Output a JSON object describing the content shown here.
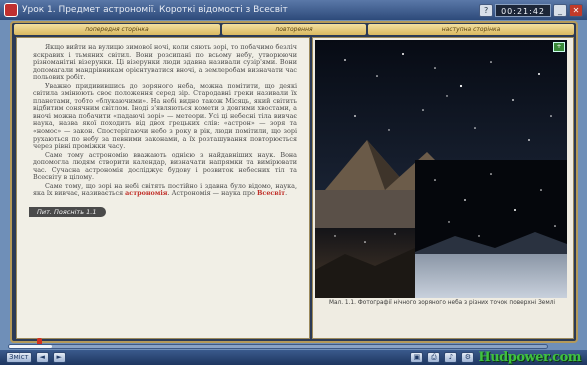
{
  "window": {
    "title": "Урок 1. Предмет астрономії. Короткі відомості з Всесвіт",
    "counter": "00:21:42",
    "buttons": {
      "help": "?",
      "minimize": "_",
      "close": "✕"
    }
  },
  "nav": {
    "tabs": [
      {
        "label": "попередня сторінка"
      },
      {
        "label": "повторення"
      },
      {
        "label": "наступна сторінка"
      }
    ]
  },
  "content": {
    "paragraphs": [
      "Якщо вийти на вулицю зимової ночі, коли сяють зорі, то побачимо безліч яскравих і тьмяних світил. Вони розсипані по всьому небу, утворюючи різноманітні візерунки. Ці візерунки люди здавна називали сузір'ями. Вони допомагали мандрівникам орієнтуватися вночі, а землеробам визначати час польових робіт.",
      "Уважно придивившись до зоряного неба, можна помітити, що деякі світила змінюють своє положення серед зір. Стародавні греки називали їх планетами, тобто «блукаючими». На небі видно також Місяць, який світить відбитим сонячним світлом. Іноді з'являються комети з довгими хвостами, а вночі можна побачити «падаючі зорі» — метеори. Усі ці небесні тіла вивчає наука, назва якої походить від двох грецьких слів: «астрон» — зоря та «номос» — закон. Спостерігаючи небо з року в рік, люди помітили, що зорі рухаються по небу за певними законами, а їх розташування повторюється через рівні проміжки часу.",
      "Саме тому астрономію вважають однією з найдавніших наук. Вона допомогла людям створити календар, визначати напрямки та вимірювати час. Сучасна астрономія досліджує будову і розвиток небесних тіл та Всесвіту в цілому."
    ],
    "closing_text": "Саме тому, що зорі на небі світять постійно і здавна було відомо, наука, яка їх вивчає, називається",
    "highlight1": "астрономія",
    "closing_text2": "Астрономія — наука про",
    "highlight2": "Всесвіт",
    "section_badge": "Пит. Поясніть 1.1"
  },
  "figure": {
    "tag": "+",
    "caption": "Мал. 1.1. Фотографії нічного зоряного неба з різних точок поверхні Землі"
  },
  "progress": {
    "value": 0.08
  },
  "taskbar": {
    "start_label": "Зміст",
    "logo": "Hudpower.com",
    "icons": [
      "prev-icon",
      "next-icon",
      "bookmark-icon",
      "print-icon",
      "sound-icon",
      "settings-icon"
    ]
  },
  "colors": {
    "accent": "#d13020",
    "frame": "#b49a5a",
    "logo": "#3fc23f"
  }
}
